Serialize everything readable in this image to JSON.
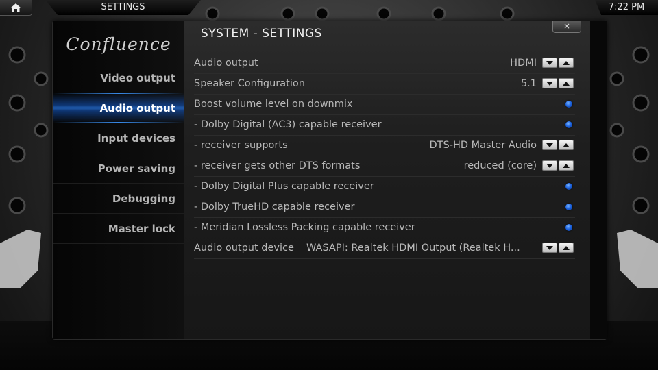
{
  "header": {
    "title": "SETTINGS",
    "clock": "7:22 PM",
    "home_icon": "home-icon"
  },
  "sidebar": {
    "logo": "Confluence",
    "items": [
      {
        "label": "Video output",
        "active": false
      },
      {
        "label": "Audio output",
        "active": true
      },
      {
        "label": "Input devices",
        "active": false
      },
      {
        "label": "Power saving",
        "active": false
      },
      {
        "label": "Debugging",
        "active": false
      },
      {
        "label": "Master lock",
        "active": false
      }
    ]
  },
  "main": {
    "title": "SYSTEM - SETTINGS",
    "close_label": "×",
    "settings": [
      {
        "label": "Audio output",
        "value": "HDMI",
        "control": "spinner"
      },
      {
        "label": "Speaker Configuration",
        "value": "5.1",
        "control": "spinner"
      },
      {
        "label": "Boost volume level on downmix",
        "value": "",
        "control": "radio"
      },
      {
        "label": "- Dolby Digital (AC3) capable receiver",
        "value": "",
        "control": "radio"
      },
      {
        "label": "- receiver supports",
        "value": "DTS-HD Master Audio",
        "control": "spinner"
      },
      {
        "label": "- receiver gets other DTS formats",
        "value": "reduced (core)",
        "control": "spinner"
      },
      {
        "label": "- Dolby Digital Plus capable receiver",
        "value": "",
        "control": "radio"
      },
      {
        "label": "- Dolby TrueHD capable receiver",
        "value": "",
        "control": "radio"
      },
      {
        "label": "- Meridian Lossless Packing capable receiver",
        "value": "",
        "control": "radio"
      },
      {
        "label": "Audio output device",
        "value": "WASAPI: Realtek HDMI Output (Realtek H...",
        "control": "spinner"
      }
    ]
  },
  "colors": {
    "accent_blue": "#1d64e0",
    "text_primary": "#b8b8b8",
    "text_active": "#ffffff"
  }
}
